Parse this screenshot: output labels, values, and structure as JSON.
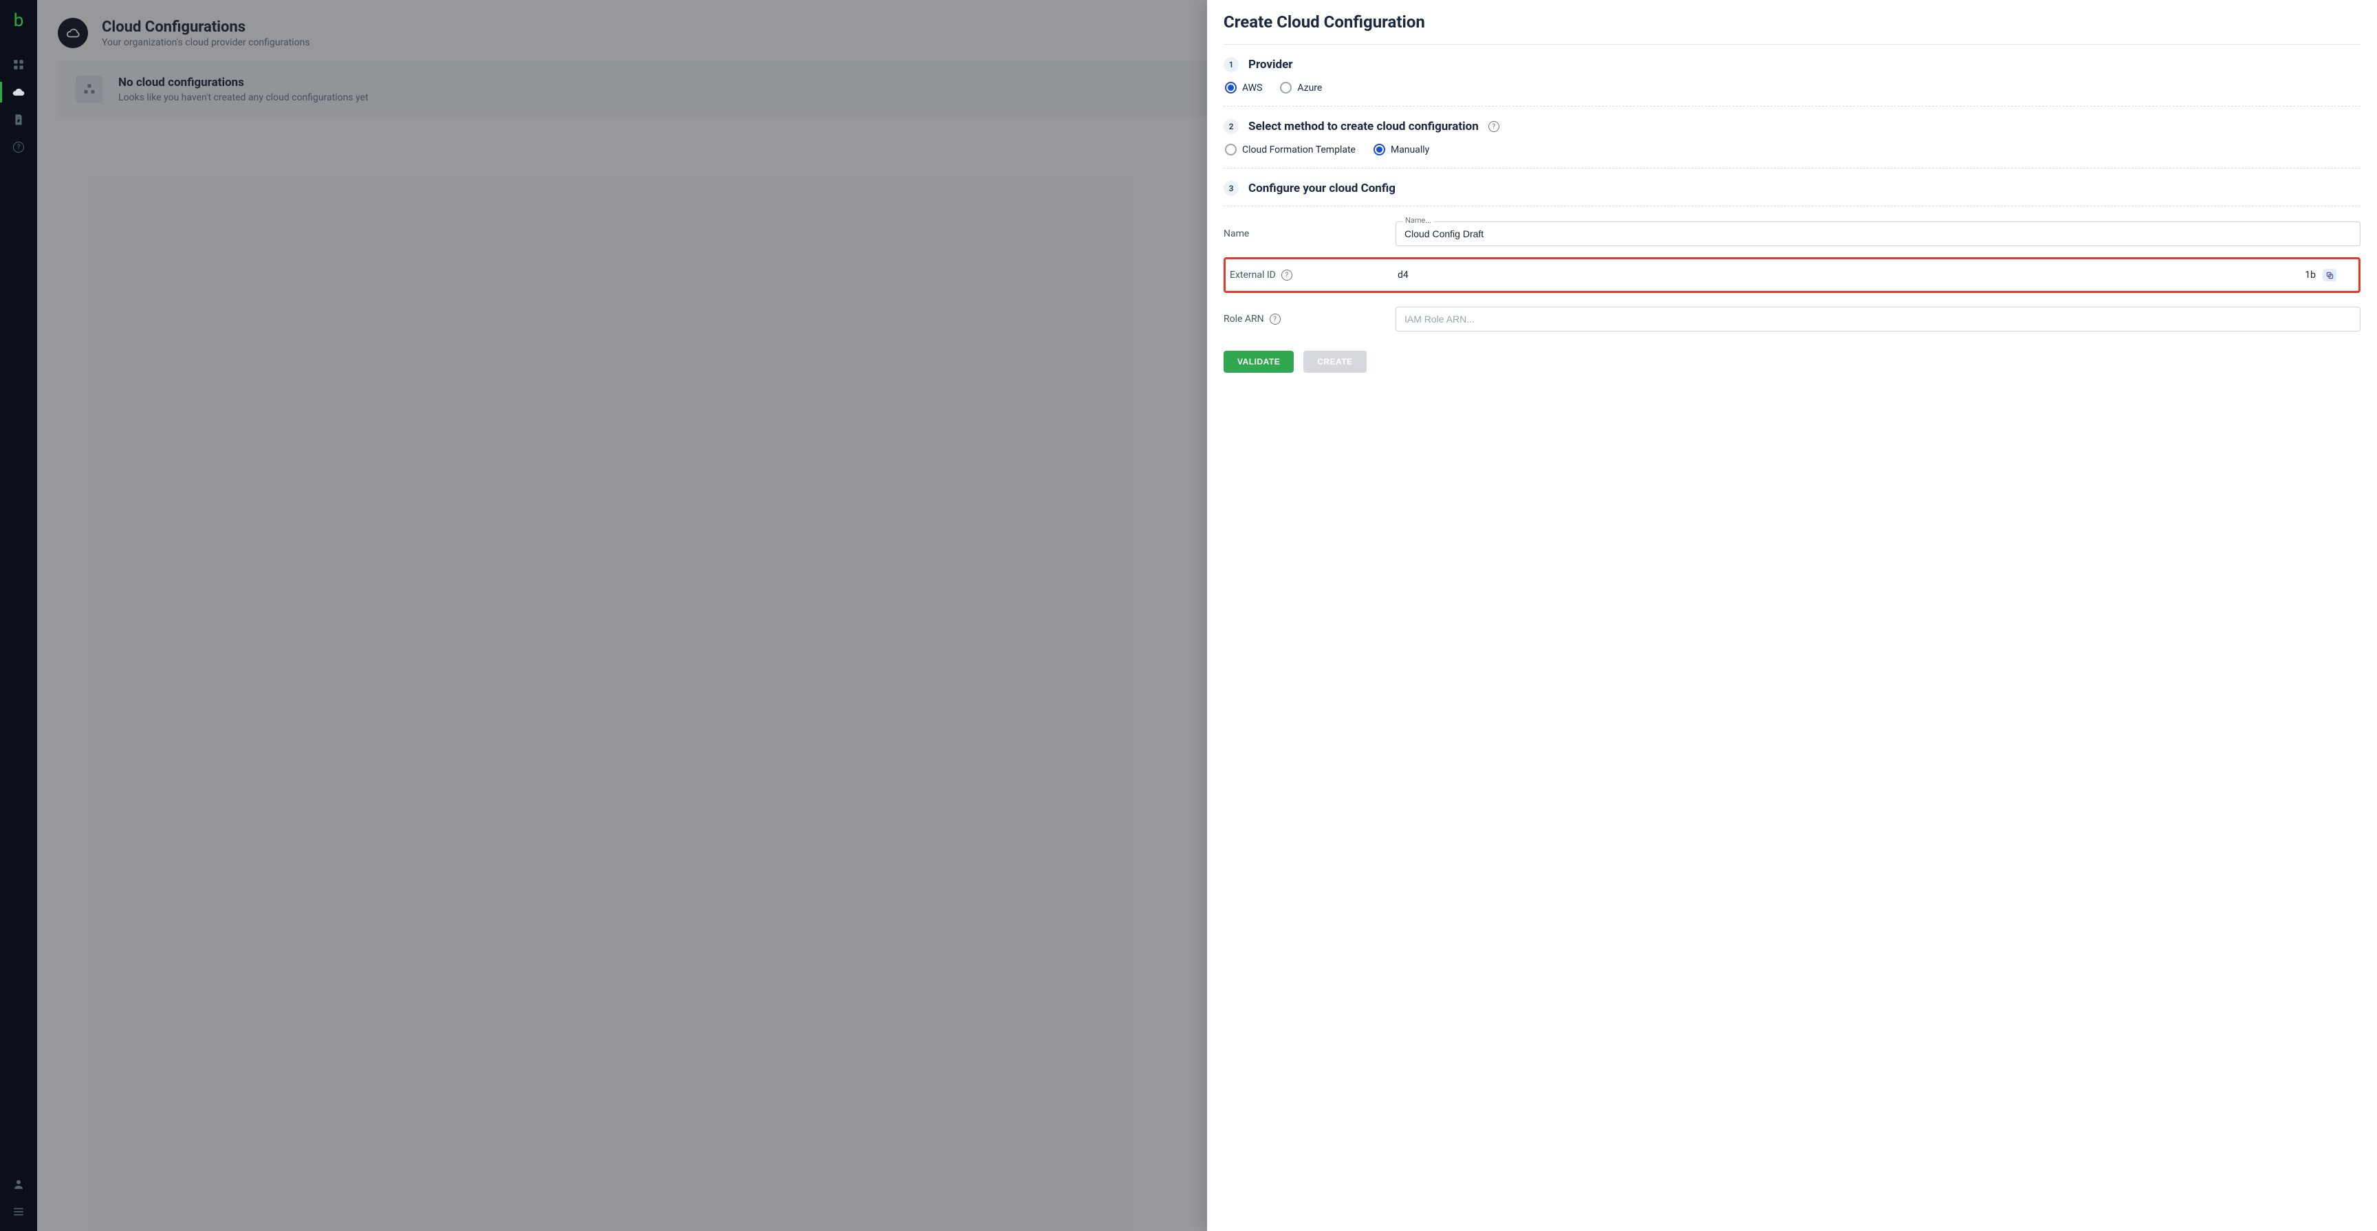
{
  "sidebar": {
    "logo_letter": "b"
  },
  "page": {
    "title": "Cloud Configurations",
    "subtitle": "Your organization's cloud provider configurations"
  },
  "empty": {
    "title": "No cloud configurations",
    "subtitle": "Looks like you haven't created any cloud configurations yet"
  },
  "drawer": {
    "title": "Create Cloud Configuration",
    "step1": {
      "num": "1",
      "title": "Provider"
    },
    "provider": {
      "aws": "AWS",
      "azure": "Azure"
    },
    "step2": {
      "num": "2",
      "title": "Select method to create cloud configuration"
    },
    "method": {
      "cft": "Cloud Formation Template",
      "manual": "Manually"
    },
    "step3": {
      "num": "3",
      "title": "Configure your cloud Config"
    },
    "name_label": "Name",
    "name_floating": "Name...",
    "name_value": "Cloud Config Draft",
    "extid_label": "External ID",
    "extid_prefix": "d4",
    "extid_suffix": "1b",
    "rolearn_label": "Role ARN",
    "rolearn_placeholder": "IAM Role ARN...",
    "validate": "VALIDATE",
    "create": "CREATE"
  }
}
